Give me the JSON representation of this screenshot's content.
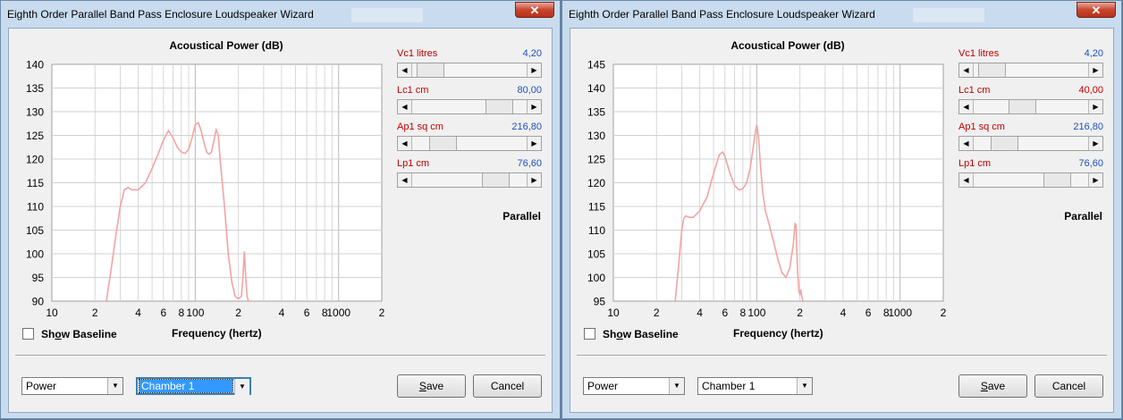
{
  "windows": [
    {
      "title": "Eighth Order Parallel Band Pass Enclosure Loudspeaker Wizard",
      "close_glyph": "✕",
      "chart_title": "Acoustical Power (dB)",
      "xlabel": "Frequency (hertz)",
      "show_baseline": {
        "label_pre": "Sh",
        "label_ul": "o",
        "label_post": "w Baseline",
        "checked": false
      },
      "params": [
        {
          "name": "Vc1  litres",
          "value": "4,20",
          "level": 0.05,
          "value_color": "#1e4fc0"
        },
        {
          "name": "Lc1  cm",
          "value": "80,00",
          "level": 0.85,
          "value_color": "#1e4fc0"
        },
        {
          "name": "Ap1  sq cm",
          "value": "216,80",
          "level": 0.2,
          "value_color": "#1e4fc0"
        },
        {
          "name": "Lp1  cm",
          "value": "76,60",
          "level": 0.8,
          "value_color": "#1e4fc0"
        }
      ],
      "mode_label": "Parallel",
      "combo_type": "Power",
      "combo_chamber": "Chamber 1",
      "chamber_selected": true,
      "save_pre": "",
      "save_ul": "S",
      "save_post": "ave",
      "cancel_label": "Cancel",
      "chart_data": {
        "type": "line",
        "ylim": [
          90,
          140
        ],
        "yticks": [
          "140",
          "135",
          "130",
          "125",
          "120",
          "115",
          "110",
          "105",
          "100",
          "95",
          "90"
        ],
        "xscale": "log",
        "xlim": [
          10,
          2000
        ],
        "xticks": [
          "10",
          "2",
          "4",
          "6",
          "8",
          "100",
          "2",
          "4",
          "6",
          "8",
          "1000",
          "2"
        ],
        "grid": true,
        "series_color": "#f4a3a3",
        "x": [
          24,
          26,
          28,
          30,
          32,
          34,
          36,
          40,
          45,
          50,
          55,
          60,
          65,
          70,
          75,
          80,
          85,
          90,
          95,
          100,
          105,
          110,
          115,
          120,
          125,
          130,
          135,
          140,
          145,
          150,
          160,
          170,
          180,
          190,
          200,
          210,
          215,
          220,
          225,
          230,
          235,
          240
        ],
        "y": [
          90,
          97,
          104,
          110,
          113.5,
          114,
          113.5,
          113.5,
          115,
          118,
          121,
          124,
          126,
          124.5,
          122.5,
          121.5,
          121.2,
          122,
          124.5,
          127.3,
          127.7,
          126,
          123.5,
          121.5,
          121,
          121.5,
          124,
          126.2,
          125,
          119,
          110,
          100,
          94,
          91,
          90.5,
          91,
          95,
          100.5,
          95,
          91,
          90,
          90
        ]
      }
    },
    {
      "title": "Eighth Order Parallel Band Pass Enclosure Loudspeaker Wizard",
      "close_glyph": "✕",
      "chart_title": "Acoustical Power (dB)",
      "xlabel": "Frequency (hertz)",
      "show_baseline": {
        "label_pre": "Sh",
        "label_ul": "o",
        "label_post": "w Baseline",
        "checked": false
      },
      "params": [
        {
          "name": "Vc1  litres",
          "value": "4,20",
          "level": 0.05,
          "value_color": "#1e4fc0"
        },
        {
          "name": "Lc1  cm",
          "value": "40,00",
          "level": 0.4,
          "value_color": "#c00000"
        },
        {
          "name": "Ap1  sq cm",
          "value": "216,80",
          "level": 0.2,
          "value_color": "#1e4fc0"
        },
        {
          "name": "Lp1  cm",
          "value": "76,60",
          "level": 0.8,
          "value_color": "#1e4fc0"
        }
      ],
      "mode_label": "Parallel",
      "combo_type": "Power",
      "combo_chamber": "Chamber 1",
      "chamber_selected": false,
      "save_pre": "",
      "save_ul": "S",
      "save_post": "ave",
      "cancel_label": "Cancel",
      "chart_data": {
        "type": "line",
        "ylim": [
          95,
          145
        ],
        "yticks": [
          "145",
          "140",
          "135",
          "130",
          "125",
          "120",
          "115",
          "110",
          "105",
          "100",
          "95"
        ],
        "xscale": "log",
        "xlim": [
          10,
          2000
        ],
        "xticks": [
          "10",
          "2",
          "4",
          "6",
          "8",
          "100",
          "2",
          "4",
          "6",
          "8",
          "1000",
          "2"
        ],
        "grid": true,
        "series_color": "#f4a3a3",
        "x": [
          27,
          28,
          29,
          30,
          31,
          32,
          34,
          36,
          40,
          45,
          50,
          55,
          58,
          60,
          65,
          70,
          75,
          80,
          85,
          90,
          95,
          98,
          100,
          103,
          106,
          110,
          115,
          120,
          130,
          140,
          150,
          160,
          170,
          180,
          185,
          188,
          190,
          193,
          197,
          200,
          203,
          206,
          210
        ],
        "y": [
          95,
          100,
          105,
          110,
          112.5,
          113,
          112.7,
          112.7,
          114,
          117,
          122,
          126,
          126.5,
          125.5,
          122,
          119.5,
          118.5,
          118.7,
          120,
          123,
          128,
          131,
          132.2,
          129.5,
          124,
          118,
          114,
          112,
          108,
          104,
          101,
          100,
          102,
          107,
          111.5,
          111,
          106,
          101,
          97,
          96.5,
          97.5,
          96,
          95
        ]
      }
    }
  ]
}
